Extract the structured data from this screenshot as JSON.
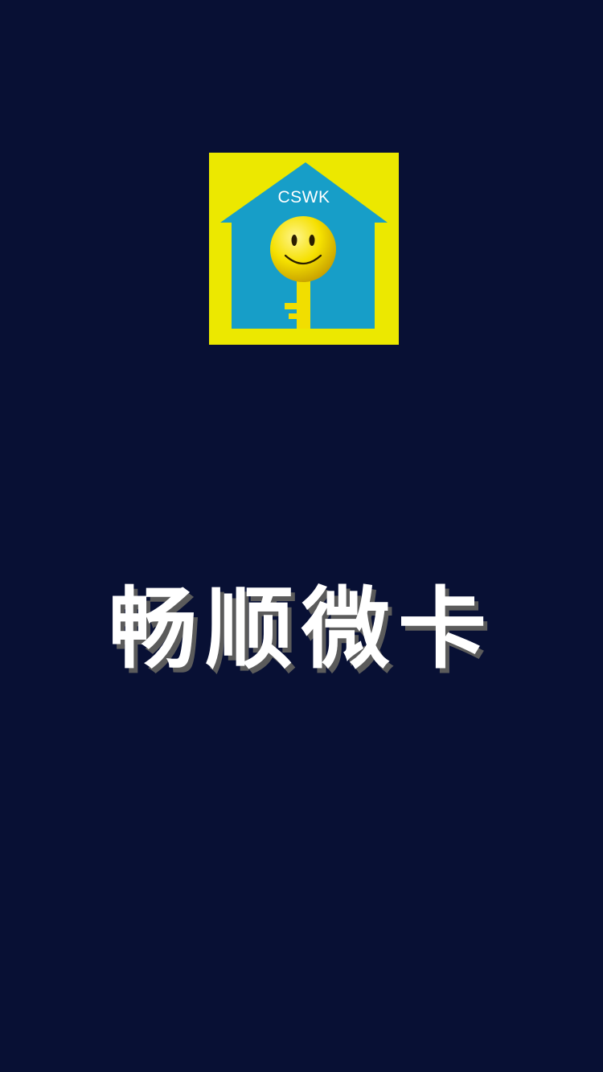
{
  "splash": {
    "logo_text": "CSWK",
    "logo_icon": "house-key-smiley-icon",
    "app_name": "畅顺微卡"
  },
  "colors": {
    "background": "#081034",
    "logo_background": "#ece800",
    "house_blue": "#179ec8",
    "smiley_yellow": "#f5e000",
    "text": "#ffffff"
  }
}
